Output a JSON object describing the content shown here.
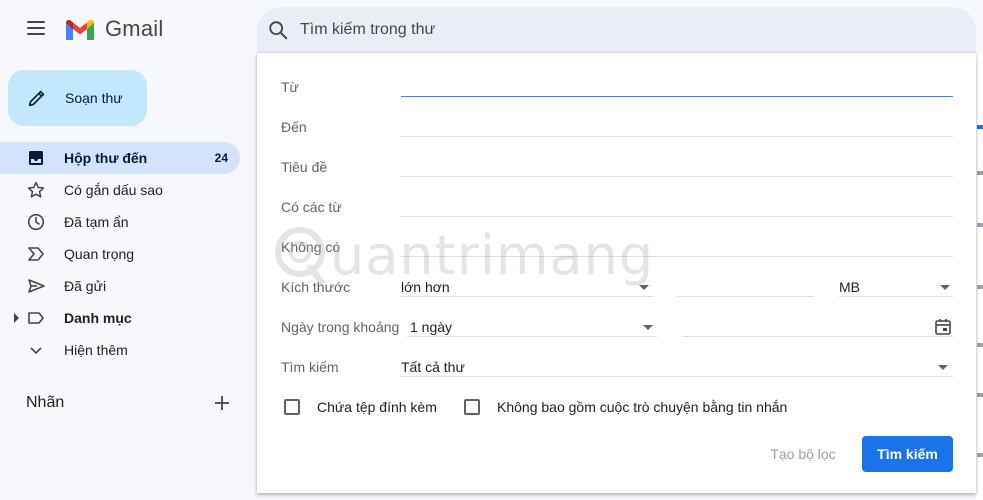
{
  "app": {
    "name": "Gmail"
  },
  "search": {
    "placeholder": "Tìm kiếm trong thư"
  },
  "sidebar": {
    "compose_label": "Soạn thư",
    "items": [
      {
        "label": "Hộp thư đến",
        "count": "24",
        "icon": "inbox-icon",
        "active": true
      },
      {
        "label": "Có gắn dấu sao",
        "icon": "star-icon"
      },
      {
        "label": "Đã tạm ẩn",
        "icon": "clock-icon"
      },
      {
        "label": "Quan trọng",
        "icon": "important-icon"
      },
      {
        "label": "Đã gửi",
        "icon": "send-icon"
      },
      {
        "label": "Danh mục",
        "icon": "label-icon",
        "bold": true
      },
      {
        "label": "Hiện thêm",
        "icon": "chevron-down-icon"
      }
    ],
    "labels_title": "Nhãn"
  },
  "advanced_search": {
    "from_label": "Từ",
    "to_label": "Đến",
    "subject_label": "Tiêu đề",
    "has_words_label": "Có các từ",
    "doesnt_have_label": "Không có",
    "size_label": "Kích thước",
    "size_operator": "lớn hơn",
    "size_unit": "MB",
    "date_within_label": "Ngày trong khoảng",
    "date_within_value": "1 ngày",
    "search_in_label": "Tìm kiếm",
    "search_in_value": "Tất cả thư",
    "has_attachment_label": "Chứa tệp đính kèm",
    "exclude_chats_label": "Không bao gồm cuộc trò chuyện bằng tin nhắn",
    "create_filter_label": "Tạo bộ lọc",
    "search_button_label": "Tìm kiếm"
  },
  "watermark": {
    "text": "uantrimang"
  },
  "colors": {
    "accent": "#1a73e8",
    "active_nav": "#d3e3fd",
    "compose": "#c2e7ff",
    "search_bar": "#e9eef6"
  }
}
